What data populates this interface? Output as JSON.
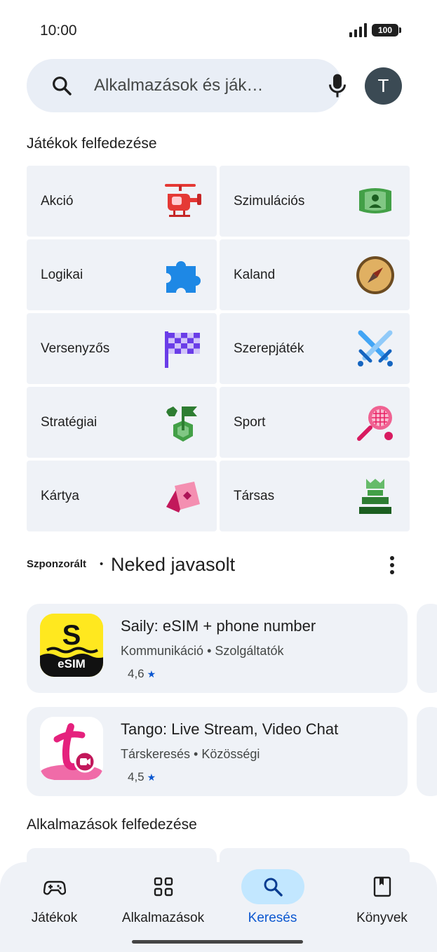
{
  "status_bar": {
    "time": "10:00",
    "battery": "100"
  },
  "search": {
    "placeholder": "Alkalmazások és ják…",
    "avatar_letter": "T"
  },
  "games_section": {
    "title": "Játékok felfedezése",
    "categories": [
      {
        "label": "Akció",
        "icon": "helicopter-icon"
      },
      {
        "label": "Szimulációs",
        "icon": "simulation-icon"
      },
      {
        "label": "Logikai",
        "icon": "puzzle-icon"
      },
      {
        "label": "Kaland",
        "icon": "compass-icon"
      },
      {
        "label": "Versenyzős",
        "icon": "checkered-flag-icon"
      },
      {
        "label": "Szerepjáték",
        "icon": "crossed-swords-icon"
      },
      {
        "label": "Stratégiai",
        "icon": "strategy-flag-icon"
      },
      {
        "label": "Sport",
        "icon": "tennis-racket-icon"
      },
      {
        "label": "Kártya",
        "icon": "cards-icon"
      },
      {
        "label": "Társas",
        "icon": "chess-piece-icon"
      }
    ]
  },
  "sponsored": {
    "label": "Szponzorált",
    "separator": "•",
    "title": "Neked javasolt",
    "apps": [
      {
        "name": "Saily: eSIM + phone number",
        "category1": "Kommunikáció",
        "category2": "Szolgáltatók",
        "rating": "4,6",
        "icon_text": "eSIM"
      },
      {
        "name": "Tango: Live Stream, Video Chat",
        "category1": "Társkeresés",
        "category2": "Közösségi",
        "rating": "4,5"
      }
    ]
  },
  "apps_section": {
    "title": "Alkalmazások felfedezése"
  },
  "bottom_nav": [
    {
      "label": "Játékok",
      "icon": "gamepad-icon"
    },
    {
      "label": "Alkalmazások",
      "icon": "apps-grid-icon"
    },
    {
      "label": "Keresés",
      "icon": "search-icon",
      "active": true
    },
    {
      "label": "Könyvek",
      "icon": "book-icon"
    }
  ],
  "colors": {
    "accent": "#0b57d0",
    "active_pill": "#c2e7ff",
    "card_bg": "#eff2f7"
  }
}
